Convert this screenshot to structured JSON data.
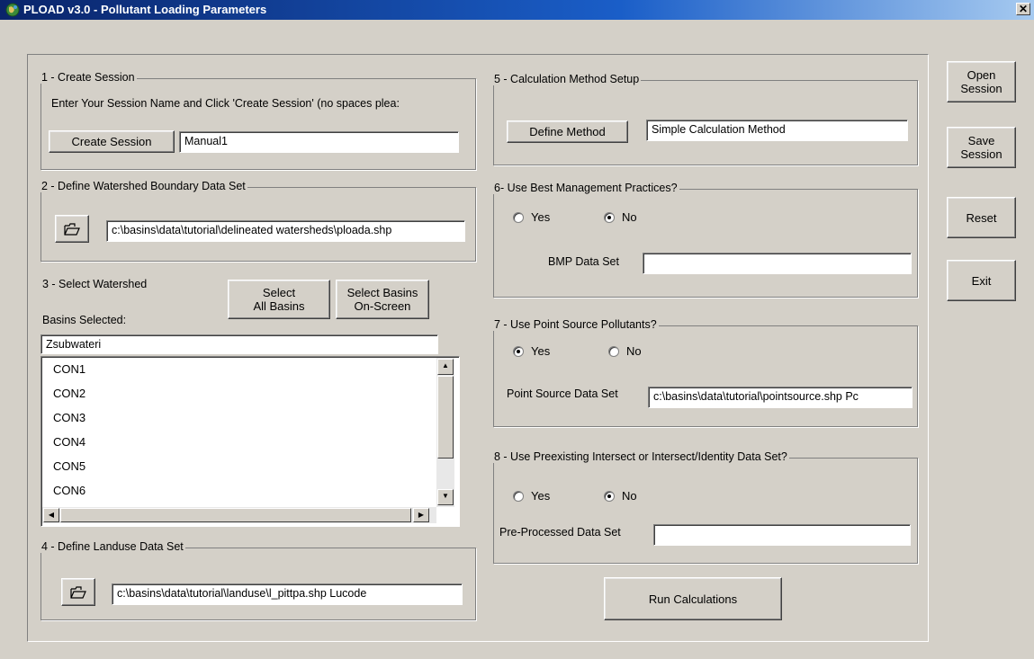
{
  "window": {
    "title": "PLOAD v3.0 - Pollutant Loading Parameters",
    "close_glyph": "✕"
  },
  "section1": {
    "legend": "1 - Create Session",
    "instruction": "Enter Your Session Name and Click 'Create Session' (no spaces plea:",
    "create_button": "Create Session",
    "session_name": "Manual1"
  },
  "section2": {
    "legend": "2 - Define Watershed Boundary Data Set",
    "path": "c:\\basins\\data\\tutorial\\delineated watersheds\\ploada.shp"
  },
  "section3": {
    "legend": "3 - Select Watershed",
    "select_all_button": "Select\nAll Basins",
    "select_onscreen_button": "Select Basins\nOn-Screen",
    "basins_selected_label": "Basins Selected:",
    "field_value": "Zsubwateri",
    "items": [
      "CON1",
      "CON2",
      "CON3",
      "CON4",
      "CON5",
      "CON6"
    ]
  },
  "section4": {
    "legend": "4 - Define Landuse Data Set",
    "path": "c:\\basins\\data\\tutorial\\landuse\\l_pittpa.shp Lucode"
  },
  "section5": {
    "legend": "5 - Calculation Method Setup",
    "define_button": "Define Method",
    "method": "Simple Calculation Method"
  },
  "section6": {
    "legend": "6- Use Best Management Practices?",
    "yes": "Yes",
    "no": "No",
    "selected": "No",
    "dataset_label": "BMP Data Set",
    "dataset_value": ""
  },
  "section7": {
    "legend": "7 - Use Point Source Pollutants?",
    "yes": "Yes",
    "no": "No",
    "selected": "Yes",
    "dataset_label": "Point Source Data Set",
    "dataset_value": "c:\\basins\\data\\tutorial\\pointsource.shp Pc"
  },
  "section8": {
    "legend": "8 - Use Preexisting Intersect or Intersect/Identity Data Set?",
    "yes": "Yes",
    "no": "No",
    "selected": "No",
    "dataset_label": "Pre-Processed Data Set",
    "dataset_value": ""
  },
  "run_button": "Run Calculations",
  "side_buttons": {
    "open": "Open\nSession",
    "save": "Save\nSession",
    "reset": "Reset",
    "exit": "Exit"
  }
}
